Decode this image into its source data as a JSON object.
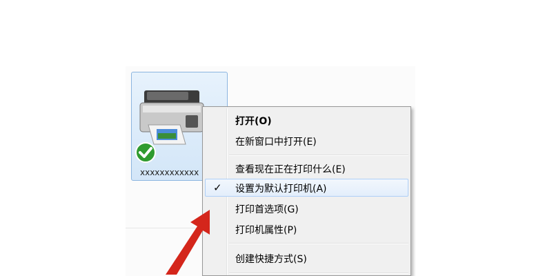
{
  "printer": {
    "name": "xxxxxxxxxxxx",
    "icon": "printer-icon",
    "status_icon": "default-check-icon",
    "status_color": "#2f9b2f"
  },
  "context_menu": {
    "items": [
      {
        "label": "打开(O)",
        "bold": true
      },
      {
        "label": "在新窗口中打开(E)"
      },
      {
        "label": "查看现在正在打印什么(E)"
      },
      {
        "label": "设置为默认打印机(A)",
        "checked": true,
        "check_mark": "✓"
      },
      {
        "label": "打印首选项(G)"
      },
      {
        "label": "打印机属性(P)"
      },
      {
        "label": "创建快捷方式(S)"
      }
    ]
  },
  "annotation": {
    "icon": "red-arrow-icon",
    "color": "#d4261b"
  }
}
